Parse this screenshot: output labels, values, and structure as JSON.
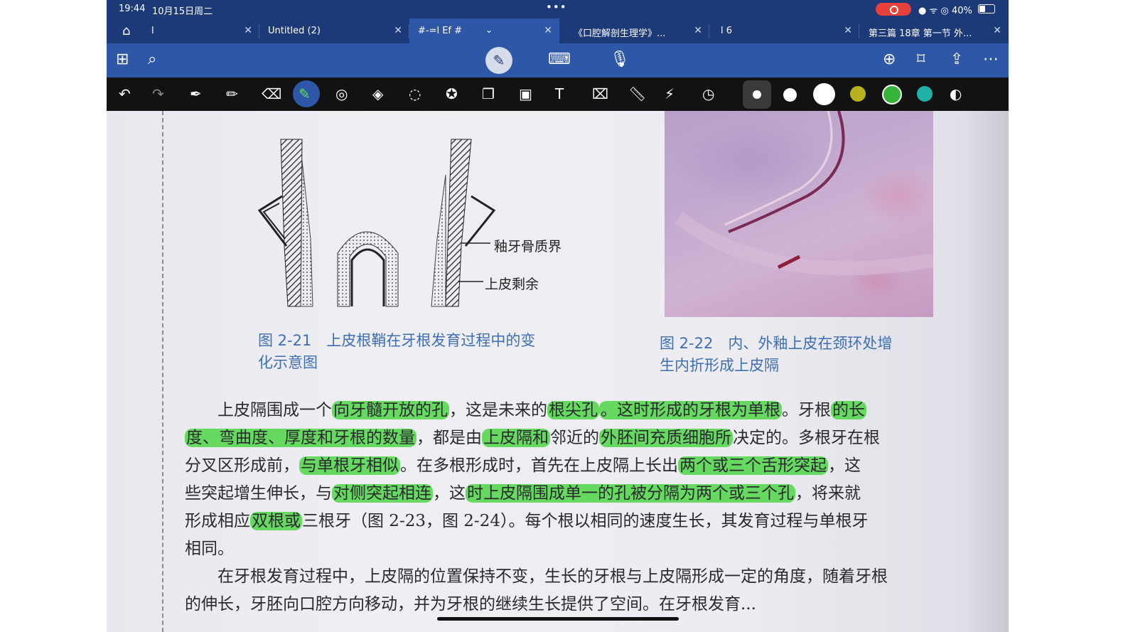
{
  "status": {
    "time": "19:44",
    "date": "10月15日周二",
    "battery": "40%"
  },
  "tabs": [
    {
      "label": "l",
      "active": false
    },
    {
      "label": "Untitled (2)",
      "active": false
    },
    {
      "label": "#-=l Ef #",
      "active": true
    },
    {
      "label": "《口腔解剖生理学》...",
      "active": false
    },
    {
      "label": "l 6",
      "active": false
    },
    {
      "label": "第三篇 18章 第一节 外...",
      "active": false
    }
  ],
  "nav_icons": [
    "home-icon",
    "grid-icon",
    "search-icon",
    "pen-mode-icon",
    "keyboard-icon",
    "mic-icon",
    "add-page-icon",
    "bookmark-icon",
    "share-icon",
    "more-icon"
  ],
  "tool_icons": [
    "undo-icon",
    "redo-icon",
    "pen-icon",
    "pencil-icon",
    "eraser-icon",
    "highlighter-icon",
    "shape-icon",
    "shapes-icon",
    "lasso-icon",
    "sticker-icon",
    "copy-icon",
    "image-icon",
    "text-icon",
    "image-search-icon",
    "ruler-icon",
    "laser-icon",
    "history-icon"
  ],
  "colors": {
    "white": "#ffffff",
    "olive": "#b7b01f",
    "green": "#36b43a",
    "teal": "#1fb2a6",
    "highlight": "#4ed646"
  },
  "figures": {
    "fig21_label_a": "釉牙骨质界",
    "fig21_label_b": "上皮剩余",
    "fig21_caption_line1": "图 2-21　上皮根鞘在牙根发育过程中的变",
    "fig21_caption_line2": "化示意图",
    "fig22_caption_line1": "图 2-22　内、外釉上皮在颈环处增",
    "fig22_caption_line2": "生内折形成上皮隔"
  },
  "body": {
    "l1a": "　　上皮隔围成一个",
    "l1b": "向牙髓开放的孔",
    "l1c": "，这是未来的",
    "l1d": "根尖孔",
    "l1e": "。这时形成的牙根为单根",
    "l1f": "。牙根",
    "l1g": "的长",
    "l2a": "度、弯曲度、厚度和牙根的数量",
    "l2b": "，都是由",
    "l2c": "上皮隔和",
    "l2d": "邻近的",
    "l2e": "外胚间充质细胞所",
    "l2f": "决定的。多根牙在根",
    "l3a": "分叉区形成前，",
    "l3b": "与单根牙相似",
    "l3c": "。在多根形成时，首先在上皮隔上长出",
    "l3d": "两个或三个舌形突起",
    "l3e": "，这",
    "l4a": "些突起增生伸长，与",
    "l4b": "对侧突起相连",
    "l4c": "，这",
    "l4d": "时上皮隔围成单一的孔被分隔为两个或三个孔",
    "l4e": "，将来就",
    "l5a": "形成相应",
    "l5b": "双根或",
    "l5c": "三根牙（图 2-23，图 2-24）。每个根以相同的速度生长，其发育过程与单根牙",
    "l6": "相同。",
    "l7": "　　在牙根发育过程中，上皮隔的位置保持不变，生长的牙根与上皮隔形成一定的角度，随着牙根",
    "l8": "的伸长，牙胚向口腔方向移动，并为牙根的继续生长提供了空间。在牙根发育..."
  }
}
